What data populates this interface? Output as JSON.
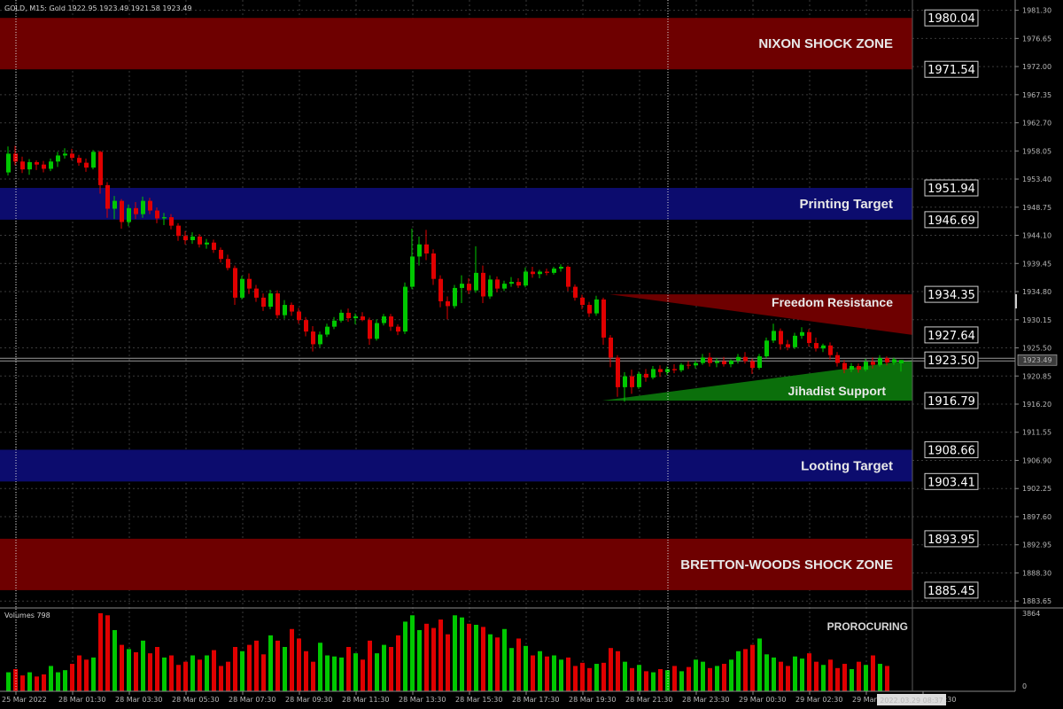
{
  "header": {
    "info": "GOLD, M15:  Gold  1922.95 1923.49 1921.58 1923.49"
  },
  "colors": {
    "background": "#000000",
    "grid": "#3a3a3a",
    "bull": "#00c800",
    "bear": "#e00000",
    "red_zone": "#6e0000",
    "blue_zone": "#0c0c6e",
    "green_zone": "#0b6f0b",
    "axis_text": "#b8b8b8"
  },
  "chart_data": {
    "type": "candlestick",
    "symbol": "GOLD",
    "timeframe": "M15",
    "ylim": [
      1882.8,
      1983.0
    ],
    "y_ticks": [
      "1981.30",
      "1976.65",
      "1972.00",
      "1967.35",
      "1962.70",
      "1958.05",
      "1953.40",
      "1948.75",
      "1944.10",
      "1939.45",
      "1934.80",
      "1930.15",
      "1925.50",
      "1920.85",
      "1916.20",
      "1911.55",
      "1906.90",
      "1902.25",
      "1897.60",
      "1892.95",
      "1888.30",
      "1883.65"
    ],
    "x_ticks": [
      "25 Mar 2022",
      "28 Mar 01:30",
      "28 Mar 03:30",
      "28 Mar 05:30",
      "28 Mar 07:30",
      "28 Mar 09:30",
      "28 Mar 11:30",
      "28 Mar 13:30",
      "28 Mar 15:30",
      "28 Mar 17:30",
      "28 Mar 19:30",
      "28 Mar 21:30",
      "28 Mar 23:30",
      "29 Mar 00:30",
      "29 Mar 02:30",
      "29 Mar 04:30",
      "29 Mar 06:30"
    ],
    "current_price": "1923.49",
    "cursor_time": "2022.03.29 08:37",
    "zones": [
      {
        "label": "NIXON SHOCK ZONE",
        "top": 1980.04,
        "bottom": 1971.54,
        "top_label": "1980.04",
        "bottom_label": "1971.54",
        "kind": "red"
      },
      {
        "label": "Printing Target",
        "top": 1951.94,
        "bottom": 1946.69,
        "top_label": "1951.94",
        "bottom_label": "1946.69",
        "kind": "blue"
      },
      {
        "label": "Looting Target",
        "top": 1908.66,
        "bottom": 1903.41,
        "top_label": "1908.66",
        "bottom_label": "1903.41",
        "kind": "blue"
      },
      {
        "label": "BRETTON-WOODS SHOCK ZONE",
        "top": 1893.95,
        "bottom": 1885.45,
        "top_label": "1893.95",
        "bottom_label": "1885.45",
        "kind": "red"
      }
    ],
    "triangles": [
      {
        "label": "Freedom Resistance",
        "top_label": "1934.35",
        "bottom_label": "1927.64",
        "apex_y": 1934.35,
        "end_top": 1934.35,
        "end_bottom": 1927.64,
        "kind": "red"
      },
      {
        "label": "Jihadist Support",
        "top_label": "1923.50",
        "bottom_label": "1916.79",
        "apex_y": 1916.79,
        "end_top": 1923.5,
        "end_bottom": 1916.79,
        "kind": "green"
      }
    ],
    "candles": [
      [
        1954.5,
        1958.8,
        1954.0,
        1957.6
      ],
      [
        1957.6,
        1958.9,
        1955.7,
        1956.3
      ],
      [
        1956.3,
        1957.1,
        1954.4,
        1955.0
      ],
      [
        1955.0,
        1956.7,
        1954.1,
        1956.2
      ],
      [
        1956.2,
        1956.5,
        1954.9,
        1955.8
      ],
      [
        1955.8,
        1956.4,
        1954.5,
        1955.1
      ],
      [
        1955.1,
        1956.8,
        1954.7,
        1956.3
      ],
      [
        1956.3,
        1957.9,
        1955.4,
        1957.3
      ],
      [
        1957.3,
        1958.5,
        1956.8,
        1957.6
      ],
      [
        1957.6,
        1958.4,
        1956.5,
        1956.9
      ],
      [
        1956.9,
        1957.4,
        1955.6,
        1956.1
      ],
      [
        1956.1,
        1956.8,
        1954.6,
        1955.3
      ],
      [
        1955.3,
        1958.2,
        1955.0,
        1957.9
      ],
      [
        1957.9,
        1958.1,
        1951.0,
        1952.4
      ],
      [
        1952.4,
        1952.9,
        1947.0,
        1948.5
      ],
      [
        1948.5,
        1950.6,
        1946.8,
        1949.8
      ],
      [
        1949.8,
        1950.1,
        1945.2,
        1946.3
      ],
      [
        1946.3,
        1949.2,
        1945.6,
        1948.6
      ],
      [
        1948.6,
        1949.6,
        1946.8,
        1947.6
      ],
      [
        1947.6,
        1950.5,
        1947.0,
        1949.8
      ],
      [
        1949.8,
        1950.3,
        1947.6,
        1948.2
      ],
      [
        1948.2,
        1948.7,
        1946.1,
        1946.9
      ],
      [
        1946.9,
        1947.8,
        1945.8,
        1947.1
      ],
      [
        1947.1,
        1947.6,
        1945.1,
        1945.7
      ],
      [
        1945.7,
        1946.1,
        1943.2,
        1944.0
      ],
      [
        1944.0,
        1944.8,
        1942.6,
        1943.3
      ],
      [
        1943.3,
        1944.6,
        1942.7,
        1943.9
      ],
      [
        1943.9,
        1944.3,
        1942.1,
        1942.6
      ],
      [
        1942.6,
        1943.5,
        1941.9,
        1942.9
      ],
      [
        1942.9,
        1943.4,
        1941.2,
        1941.7
      ],
      [
        1941.7,
        1942.1,
        1939.6,
        1940.2
      ],
      [
        1940.2,
        1940.9,
        1938.3,
        1938.7
      ],
      [
        1938.7,
        1939.1,
        1932.6,
        1933.8
      ],
      [
        1933.8,
        1937.4,
        1933.5,
        1936.9
      ],
      [
        1936.9,
        1937.8,
        1934.4,
        1935.3
      ],
      [
        1935.3,
        1935.9,
        1933.1,
        1933.8
      ],
      [
        1933.8,
        1934.5,
        1931.6,
        1932.3
      ],
      [
        1932.3,
        1935.1,
        1931.9,
        1934.5
      ],
      [
        1934.5,
        1935.0,
        1930.4,
        1930.9
      ],
      [
        1930.9,
        1933.4,
        1930.3,
        1932.6
      ],
      [
        1932.6,
        1933.0,
        1930.8,
        1931.5
      ],
      [
        1931.5,
        1932.1,
        1929.5,
        1930.1
      ],
      [
        1930.1,
        1930.6,
        1927.4,
        1928.2
      ],
      [
        1928.2,
        1929.1,
        1924.9,
        1926.1
      ],
      [
        1926.1,
        1928.2,
        1925.6,
        1927.7
      ],
      [
        1927.7,
        1929.5,
        1927.3,
        1929.0
      ],
      [
        1929.0,
        1930.6,
        1928.6,
        1930.0
      ],
      [
        1930.0,
        1931.8,
        1929.7,
        1931.3
      ],
      [
        1931.3,
        1932.0,
        1929.8,
        1930.4
      ],
      [
        1930.4,
        1931.2,
        1929.4,
        1930.7
      ],
      [
        1930.7,
        1931.4,
        1929.9,
        1930.1
      ],
      [
        1930.1,
        1930.5,
        1926.0,
        1927.0
      ],
      [
        1927.0,
        1930.2,
        1926.7,
        1929.6
      ],
      [
        1929.6,
        1931.1,
        1929.2,
        1930.7
      ],
      [
        1930.7,
        1931.1,
        1928.3,
        1929.0
      ],
      [
        1929.0,
        1929.4,
        1927.6,
        1928.2
      ],
      [
        1928.2,
        1936.3,
        1927.8,
        1935.6
      ],
      [
        1935.6,
        1945.2,
        1935.2,
        1940.6
      ],
      [
        1940.6,
        1943.9,
        1939.1,
        1942.6
      ],
      [
        1942.6,
        1945.0,
        1940.0,
        1941.1
      ],
      [
        1941.1,
        1941.8,
        1935.9,
        1936.9
      ],
      [
        1936.9,
        1937.5,
        1932.2,
        1933.2
      ],
      [
        1933.2,
        1934.0,
        1930.2,
        1932.4
      ],
      [
        1932.4,
        1935.9,
        1932.0,
        1935.4
      ],
      [
        1935.4,
        1937.5,
        1932.9,
        1936.1
      ],
      [
        1936.1,
        1937.0,
        1934.4,
        1935.0
      ],
      [
        1935.0,
        1942.3,
        1934.6,
        1937.9
      ],
      [
        1937.9,
        1939.1,
        1932.9,
        1934.0
      ],
      [
        1934.0,
        1937.5,
        1933.6,
        1936.8
      ],
      [
        1936.8,
        1937.3,
        1934.7,
        1935.3
      ],
      [
        1935.3,
        1936.6,
        1934.9,
        1936.1
      ],
      [
        1936.1,
        1937.2,
        1935.6,
        1936.4
      ],
      [
        1936.4,
        1937.0,
        1935.4,
        1935.8
      ],
      [
        1935.8,
        1938.8,
        1935.5,
        1938.1
      ],
      [
        1938.1,
        1938.9,
        1937.1,
        1937.7
      ],
      [
        1937.7,
        1938.4,
        1937.0,
        1938.1
      ],
      [
        1938.1,
        1938.6,
        1937.5,
        1937.9
      ],
      [
        1937.9,
        1938.9,
        1937.6,
        1938.6
      ],
      [
        1938.6,
        1939.3,
        1938.1,
        1938.9
      ],
      [
        1938.9,
        1939.1,
        1934.9,
        1935.6
      ],
      [
        1935.6,
        1936.0,
        1933.3,
        1933.8
      ],
      [
        1933.8,
        1934.3,
        1931.9,
        1932.6
      ],
      [
        1932.6,
        1933.1,
        1930.6,
        1931.2
      ],
      [
        1931.2,
        1934.1,
        1930.8,
        1933.5
      ],
      [
        1933.5,
        1933.8,
        1926.0,
        1927.2
      ],
      [
        1927.2,
        1927.6,
        1922.3,
        1923.9
      ],
      [
        1923.9,
        1924.3,
        1917.4,
        1919.0
      ],
      [
        1919.0,
        1921.5,
        1916.6,
        1920.8
      ],
      [
        1920.8,
        1921.9,
        1917.9,
        1919.0
      ],
      [
        1919.0,
        1921.6,
        1918.7,
        1921.2
      ],
      [
        1921.2,
        1922.0,
        1919.9,
        1920.6
      ],
      [
        1920.6,
        1922.5,
        1920.3,
        1922.0
      ],
      [
        1922.0,
        1922.6,
        1920.7,
        1921.5
      ],
      [
        1921.5,
        1922.4,
        1921.0,
        1922.0
      ],
      [
        1922.0,
        1922.8,
        1921.3,
        1921.8
      ],
      [
        1921.8,
        1923.0,
        1921.5,
        1922.7
      ],
      [
        1922.7,
        1923.3,
        1922.0,
        1922.6
      ],
      [
        1922.6,
        1923.4,
        1922.1,
        1923.0
      ],
      [
        1923.0,
        1924.5,
        1922.7,
        1923.9
      ],
      [
        1923.9,
        1924.7,
        1922.4,
        1923.0
      ],
      [
        1923.0,
        1923.8,
        1922.3,
        1923.3
      ],
      [
        1923.3,
        1924.0,
        1922.4,
        1922.8
      ],
      [
        1922.8,
        1923.6,
        1922.3,
        1923.4
      ],
      [
        1923.4,
        1924.5,
        1922.9,
        1924.0
      ],
      [
        1924.0,
        1924.8,
        1922.9,
        1923.3
      ],
      [
        1923.3,
        1923.7,
        1921.2,
        1922.2
      ],
      [
        1922.2,
        1924.5,
        1921.9,
        1924.1
      ],
      [
        1924.1,
        1927.2,
        1923.8,
        1926.7
      ],
      [
        1926.7,
        1929.5,
        1926.3,
        1928.3
      ],
      [
        1928.3,
        1928.7,
        1925.2,
        1926.1
      ],
      [
        1926.1,
        1926.8,
        1925.1,
        1925.6
      ],
      [
        1925.6,
        1928.0,
        1925.3,
        1927.5
      ],
      [
        1927.5,
        1928.9,
        1927.0,
        1928.1
      ],
      [
        1928.1,
        1928.6,
        1925.7,
        1926.3
      ],
      [
        1926.3,
        1927.2,
        1924.9,
        1925.4
      ],
      [
        1925.4,
        1926.2,
        1924.8,
        1925.9
      ],
      [
        1925.9,
        1926.4,
        1923.6,
        1924.3
      ],
      [
        1924.3,
        1924.8,
        1922.4,
        1923.0
      ],
      [
        1923.0,
        1923.5,
        1921.3,
        1921.9
      ],
      [
        1921.9,
        1923.0,
        1921.5,
        1922.5
      ],
      [
        1922.5,
        1922.9,
        1921.4,
        1921.9
      ],
      [
        1921.9,
        1923.7,
        1921.6,
        1923.2
      ],
      [
        1923.2,
        1923.9,
        1922.1,
        1922.7
      ],
      [
        1922.7,
        1924.3,
        1922.4,
        1923.8
      ],
      [
        1923.8,
        1924.1,
        1922.6,
        1923.1
      ],
      [
        1923.1,
        1923.9,
        1922.7,
        1923.6
      ],
      [
        1922.95,
        1923.49,
        1921.58,
        1923.49
      ]
    ],
    "volume": {
      "label": "Volumes 798",
      "max_label": "3864",
      "min_label": "0",
      "ymax": 3864,
      "values": [
        900,
        1050,
        750,
        900,
        700,
        800,
        1200,
        900,
        1000,
        1300,
        1700,
        1500,
        1600,
        3700,
        3600,
        2900,
        2200,
        2000,
        1850,
        2400,
        1800,
        2100,
        1600,
        1700,
        1250,
        1400,
        1700,
        1500,
        1700,
        1950,
        1200,
        1400,
        2100,
        1900,
        2200,
        2400,
        1750,
        2650,
        2400,
        2100,
        2950,
        2500,
        1900,
        1400,
        2300,
        1700,
        1650,
        1600,
        2100,
        1800,
        1500,
        2400,
        1800,
        2200,
        2100,
        2650,
        3300,
        3600,
        2900,
        3200,
        3000,
        3400,
        2700,
        3600,
        3500,
        3200,
        3150,
        3050,
        2700,
        2550,
        2950,
        2050,
        2500,
        2150,
        1700,
        1900,
        1650,
        1700,
        1500,
        1600,
        1200,
        1350,
        1100,
        1300,
        1350,
        2050,
        1900,
        1400,
        1100,
        1250,
        950,
        900,
        1050,
        1000,
        1200,
        950,
        1150,
        1500,
        1400,
        1100,
        1200,
        1300,
        1500,
        1900,
        2000,
        2200,
        2500,
        1750,
        1600,
        1400,
        1200,
        1650,
        1550,
        1800,
        1400,
        1250,
        1500,
        1100,
        1300,
        1050,
        1400,
        1250,
        1700,
        1300,
        1200
      ]
    },
    "volume_caption": "PROROCURING"
  }
}
